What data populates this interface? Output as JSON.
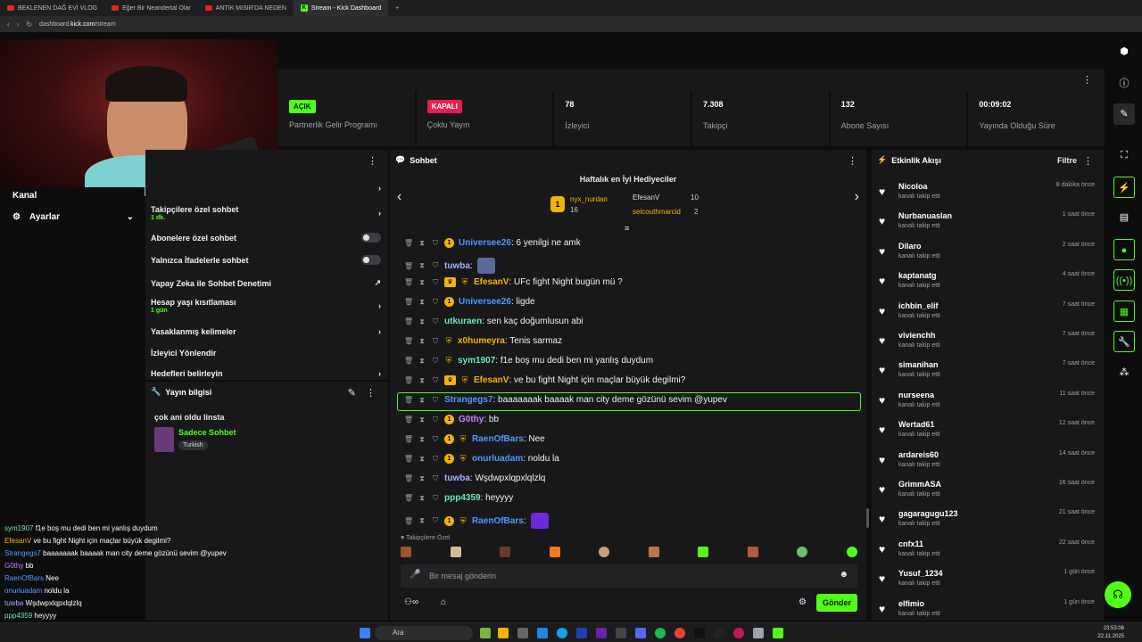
{
  "browser": {
    "tabs": [
      "BEKLENEN DAĞ EVİ VLOG",
      "Eğer Bir Neandertal Olar",
      "ANTİK MISIR'DA NEDEN",
      "Stream - Kick Dashboard"
    ],
    "url_prefix": "dashboard.",
    "url_domain": "kick.com",
    "url_path": "/stream"
  },
  "stats": [
    {
      "pill": "AÇIK",
      "label": "Partnerlik Gelir Programı"
    },
    {
      "pill": "KAPALI",
      "label": "Çoklu Yayın"
    },
    {
      "value": "78",
      "label": "İzleyici"
    },
    {
      "value": "7.308",
      "label": "Takipçi"
    },
    {
      "value": "132",
      "label": "Abone Sayısı"
    },
    {
      "value": "00:09:02",
      "label": "Yayında Olduğu Süre"
    }
  ],
  "left_nav": {
    "kanal": "Kanal",
    "ayarlar": "Ayarlar"
  },
  "chat_settings": {
    "rows": [
      {
        "label": "Takipçilere özel sohbet",
        "sub": "1 dk."
      },
      {
        "label": "Abonelere özel sohbet"
      },
      {
        "label": "Yalnızca İfadelerle sohbet"
      },
      {
        "label": "Yapay Zeka ile Sohbet Denetimi"
      },
      {
        "label": "Hesap yaşı kısıtlaması",
        "sub": "1 gün"
      },
      {
        "label": "Yasaklanmış kelimeler"
      },
      {
        "label": "İzleyici Yönlendir"
      },
      {
        "label": "Hedefleri belirleyin"
      }
    ]
  },
  "stream_info": {
    "header": "Yayın bilgisi",
    "title": "çok ani oldu linsta",
    "category": "Sadece Sohbet",
    "tag": "Turkish"
  },
  "chat": {
    "header": "Sohbet",
    "gifters_title": "Haftalık en İyi Hediyeciler",
    "top_gifter": {
      "name": "nyx_nurdan",
      "count": "16"
    },
    "gifter2": {
      "name": "EfesanV",
      "count": "10"
    },
    "gifter3": {
      "name": "selcouthmarcid",
      "count": "2"
    },
    "messages": [
      {
        "user": "Universee26",
        "color": "#4c9aff",
        "text": ": 6 yenilgi ne amk"
      },
      {
        "user": "tuwba",
        "color": "#9fb3ff",
        "text": ":"
      },
      {
        "user": "EfesanV",
        "color": "#f5b301",
        "text": ": UFc fight Night bugün mü ?"
      },
      {
        "user": "Universee26",
        "color": "#4c9aff",
        "text": ": ligde"
      },
      {
        "user": "utkuraen",
        "color": "#6ee7b7",
        "text": ": sen kaç doğumlusun abi"
      },
      {
        "user": "x0humeyra",
        "color": "#f5b301",
        "text": ": Tenis sarmaz"
      },
      {
        "user": "sym1907",
        "color": "#6ee7b7",
        "text": ": f1e boş mu dedi ben mi yanlış duydum"
      },
      {
        "user": "EfesanV",
        "color": "#f5b301",
        "text": ": ve bu fight Night için maçlar büyük degilmi?"
      },
      {
        "user": "Strangegs7",
        "color": "#4c9aff",
        "text": ": baaaaaaak baaaak man city deme gözünü sevim @yupev"
      },
      {
        "user": "G0thy",
        "color": "#c084fc",
        "text": ": bb"
      },
      {
        "user": "RaenOfBars",
        "color": "#4c9aff",
        "text": ": Nee"
      },
      {
        "user": "onurluadam",
        "color": "#4c9aff",
        "text": ": noldu la"
      },
      {
        "user": "tuwba",
        "color": "#9fb3ff",
        "text": ": Wşdwpxlqpxlqlzlq"
      },
      {
        "user": "ppp4359",
        "color": "#6ee7b7",
        "text": ": heyyyy"
      },
      {
        "user": "RaenOfBars",
        "color": "#4c9aff",
        "text": ":"
      }
    ],
    "followers_only": "Takipçilere Özel",
    "input_placeholder": "Bir mesaj gönderin",
    "send_label": "Gönder"
  },
  "feed": {
    "header": "Etkinlik Akışı",
    "filter": "Filtre",
    "items": [
      {
        "name": "Nicoloa",
        "sub": "kanalı takip etti",
        "time": "8 dakika önce"
      },
      {
        "name": "Nurbanuaslan",
        "sub": "kanalı takip etti",
        "time": "1 saat önce"
      },
      {
        "name": "Dilaro",
        "sub": "kanalı takip etti",
        "time": "2 saat önce"
      },
      {
        "name": "kaptanatg",
        "sub": "kanalı takip etti",
        "time": "4 saat önce"
      },
      {
        "name": "ichbin_elif",
        "sub": "kanalı takip etti",
        "time": "7 saat önce"
      },
      {
        "name": "vivienchh",
        "sub": "kanalı takip etti",
        "time": "7 saat önce"
      },
      {
        "name": "simanihan",
        "sub": "kanalı takip etti",
        "time": "7 saat önce"
      },
      {
        "name": "nurseena",
        "sub": "kanalı takip etti",
        "time": "11 saat önce"
      },
      {
        "name": "Wertad61",
        "sub": "kanalı takip etti",
        "time": "12 saat önce"
      },
      {
        "name": "ardareis60",
        "sub": "kanalı takip etti",
        "time": "14 saat önce"
      },
      {
        "name": "GrimmASA",
        "sub": "kanalı takip etti",
        "time": "16 saat önce"
      },
      {
        "name": "gagaragugu123",
        "sub": "kanalı takip etti",
        "time": "21 saat önce"
      },
      {
        "name": "cnfx11",
        "sub": "kanalı takip etti",
        "time": "22 saat önce"
      },
      {
        "name": "Yusuf_1234",
        "sub": "kanalı takip etti",
        "time": "1 gün önce"
      },
      {
        "name": "elfimio",
        "sub": "kanalı takip etti",
        "time": "1 gün önce"
      }
    ]
  },
  "overlay_chat": [
    {
      "user": "sym1907",
      "color": "#6ee7b7",
      "text": "f1e boş mu dedi ben mi yanlış duydum"
    },
    {
      "user": "EfesanV",
      "color": "#f5b301",
      "text": "ve bu fight Night için maçlar büyük degilmi?"
    },
    {
      "user": "Strangegs7",
      "color": "#4c9aff",
      "text": "baaaaaaak baaaak man city deme gözünü sevim @yupev"
    },
    {
      "user": "G0thy",
      "color": "#c084fc",
      "text": "bb"
    },
    {
      "user": "RaenOfBars",
      "color": "#4c9aff",
      "text": "Nee"
    },
    {
      "user": "onurluadam",
      "color": "#4c9aff",
      "text": "noldu la"
    },
    {
      "user": "tuwba",
      "color": "#9fb3ff",
      "text": "Wşdwpxlqpxlqlzlq"
    },
    {
      "user": "ppp4359",
      "color": "#6ee7b7",
      "text": "heyyyy"
    }
  ],
  "taskbar": {
    "search": "Ara",
    "time": "23:53:06",
    "date": "22.11.2025"
  },
  "colors": {
    "accent": "#53fc18",
    "panel": "#18181a",
    "bg": "#0d0d0e",
    "red": "#e91e4b"
  }
}
